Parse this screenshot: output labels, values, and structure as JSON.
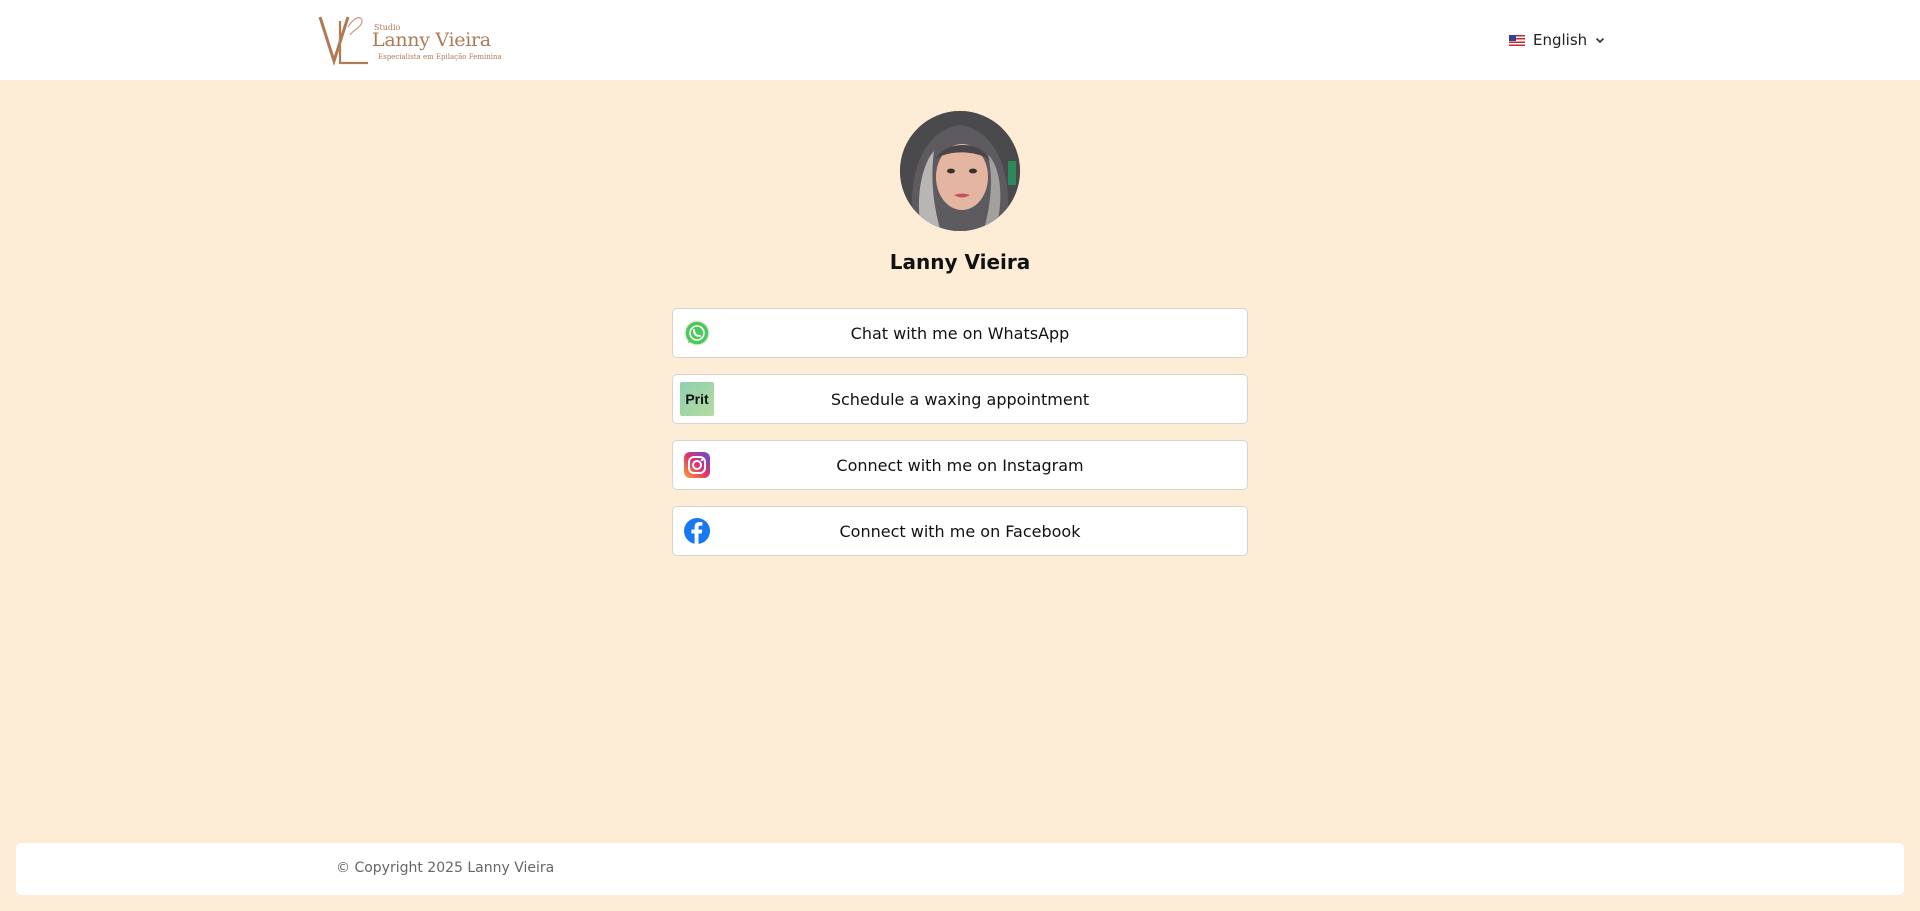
{
  "header": {
    "logo": {
      "small_text": "Studio",
      "brand_text": "Lanny Vieira",
      "tagline": "Especialista em Epilação Feminina",
      "color": "#b07a57"
    },
    "language": {
      "label": "English",
      "flag_icon": "us-flag-icon"
    }
  },
  "profile": {
    "name": "Lanny Vieira"
  },
  "links": [
    {
      "label": "Chat with me on WhatsApp",
      "icon": "whatsapp-icon",
      "color": "#4ac959"
    },
    {
      "label": "Schedule a waxing appointment",
      "icon": "prit-icon",
      "icon_text": "Prit",
      "color": "#8fd3a8"
    },
    {
      "label": "Connect with me on Instagram",
      "icon": "instagram-icon",
      "color": "#e1306c"
    },
    {
      "label": "Connect with me on Facebook",
      "icon": "facebook-icon",
      "color": "#1877f2"
    }
  ],
  "footer": {
    "copyright": "© Copyright 2025 Lanny Vieira"
  },
  "colors": {
    "background": "#fdedd6",
    "surface": "#ffffff"
  }
}
